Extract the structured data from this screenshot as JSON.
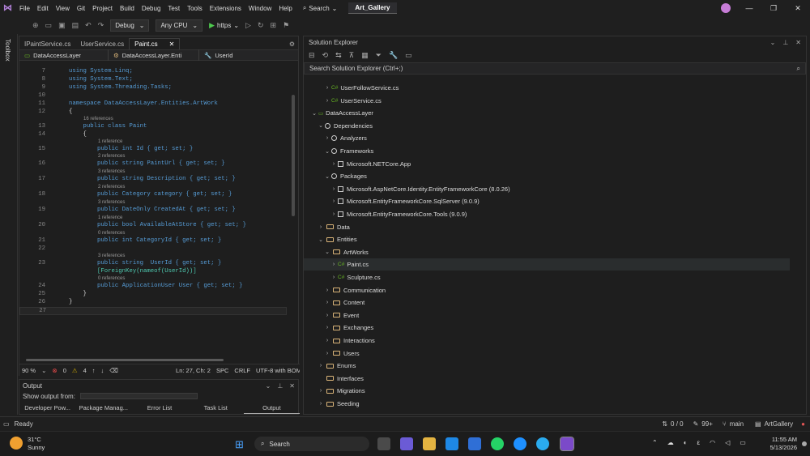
{
  "titlebar": {
    "menu": [
      "File",
      "Edit",
      "View",
      "Git",
      "Project",
      "Build",
      "Debug",
      "Test",
      "Tools",
      "Extensions",
      "Window",
      "Help"
    ],
    "search_label": "Search",
    "solution_name": "Art_Gallery"
  },
  "toolbar": {
    "config": "Debug",
    "platform": "Any CPU",
    "run_label": "https"
  },
  "toolbox_label": "Toolbox",
  "editor": {
    "tabs": [
      "IPaintService.cs",
      "UserService.cs",
      "Paint.cs"
    ],
    "nav": {
      "project": "DataAccessLayer",
      "type": "DataAccessLayer.Enti",
      "member": "UserId"
    },
    "status": {
      "zoom": "90 %",
      "errors": "0",
      "warnings": "4",
      "position": "Ln: 27, Ch: 2",
      "spc": "SPC",
      "eol": "CRLF",
      "encoding": "UTF-8 with BOM"
    }
  },
  "code": {
    "lines": [
      {
        "n": "7",
        "t": "using System.Linq;"
      },
      {
        "n": "8",
        "t": "using System.Text;"
      },
      {
        "n": "9",
        "t": "using System.Threading.Tasks;"
      },
      {
        "n": "10",
        "t": ""
      },
      {
        "n": "11",
        "t": "namespace DataAccessLayer.Entities.ArtWork"
      },
      {
        "n": "12",
        "t": "{"
      },
      {
        "n": "13",
        "t": "    public class Paint",
        "ref": "16 references"
      },
      {
        "n": "14",
        "t": "    {"
      },
      {
        "n": "15",
        "t": "        public int Id { get; set; }",
        "ref": "1 reference"
      },
      {
        "n": "16",
        "t": "        public string PaintUrl { get; set; }",
        "ref": "2 references"
      },
      {
        "n": "17",
        "t": "        public string Description { get; set; }",
        "ref": "3 references"
      },
      {
        "n": "18",
        "t": "        public Category category { get; set; }",
        "ref": "2 references"
      },
      {
        "n": "19",
        "t": "        public DateOnly CreatedAt { get; set; }",
        "ref": "3 references"
      },
      {
        "n": "20",
        "t": "        public bool AvailableAtStore { get; set; }",
        "ref": "1 reference"
      },
      {
        "n": "21",
        "t": "        public int CategoryId { get; set; }",
        "ref": "0 references"
      },
      {
        "n": "22",
        "t": ""
      },
      {
        "n": "23",
        "t": "        public string  UserId { get; set; }",
        "ref": "3 references"
      },
      {
        "n": "",
        "t": "        [ForeignKey(nameof(UserId))]"
      },
      {
        "n": "24",
        "t": "        public ApplicationUser User { get; set; }",
        "ref": "0 references"
      },
      {
        "n": "25",
        "t": "    }"
      },
      {
        "n": "26",
        "t": "}"
      },
      {
        "n": "27",
        "t": ""
      }
    ]
  },
  "output": {
    "title": "Output",
    "show_from": "Show output from:",
    "tabs": [
      "Developer Pow...",
      "Package Manag...",
      "Error List",
      "Task List",
      "Output"
    ]
  },
  "solution_explorer": {
    "title": "Solution Explorer",
    "search_placeholder": "Search Solution Explorer (Ctrl+;)",
    "items": [
      {
        "label": "UserFollowService.cs",
        "kind": "cs",
        "indent": 2,
        "chev": ">"
      },
      {
        "label": "UserService.cs",
        "kind": "cs",
        "indent": 2,
        "chev": ">"
      },
      {
        "label": "DataAccessLayer",
        "kind": "proj",
        "indent": 0,
        "chev": "v"
      },
      {
        "label": "Dependencies",
        "kind": "dep",
        "indent": 1,
        "chev": "v"
      },
      {
        "label": "Analyzers",
        "kind": "dep",
        "indent": 2,
        "chev": ">"
      },
      {
        "label": "Frameworks",
        "kind": "dep",
        "indent": 2,
        "chev": "v"
      },
      {
        "label": "Microsoft.NETCore.App",
        "kind": "pkg",
        "indent": 3,
        "chev": ">"
      },
      {
        "label": "Packages",
        "kind": "dep",
        "indent": 2,
        "chev": "v"
      },
      {
        "label": "Microsoft.AspNetCore.Identity.EntityFrameworkCore (8.0.26)",
        "kind": "pkg",
        "indent": 3,
        "chev": ">"
      },
      {
        "label": "Microsoft.EntityFrameworkCore.SqlServer (9.0.9)",
        "kind": "pkg",
        "indent": 3,
        "chev": ">"
      },
      {
        "label": "Microsoft.EntityFrameworkCore.Tools (9.0.9)",
        "kind": "pkg",
        "indent": 3,
        "chev": ">"
      },
      {
        "label": "Data",
        "kind": "folder",
        "indent": 1,
        "chev": ">"
      },
      {
        "label": "Entities",
        "kind": "folder",
        "indent": 1,
        "chev": "v"
      },
      {
        "label": "ArtWorks",
        "kind": "folder",
        "indent": 2,
        "chev": "v"
      },
      {
        "label": "Paint.cs",
        "kind": "cs",
        "indent": 3,
        "chev": ">",
        "selected": true
      },
      {
        "label": "Sculpture.cs",
        "kind": "cs",
        "indent": 3,
        "chev": ">"
      },
      {
        "label": "Communication",
        "kind": "folder",
        "indent": 2,
        "chev": ">"
      },
      {
        "label": "Content",
        "kind": "folder",
        "indent": 2,
        "chev": ">"
      },
      {
        "label": "Event",
        "kind": "folder",
        "indent": 2,
        "chev": ">"
      },
      {
        "label": "Exchanges",
        "kind": "folder",
        "indent": 2,
        "chev": ">"
      },
      {
        "label": "Interactions",
        "kind": "folder",
        "indent": 2,
        "chev": ">"
      },
      {
        "label": "Users",
        "kind": "folder",
        "indent": 2,
        "chev": ">"
      },
      {
        "label": "Enums",
        "kind": "folder",
        "indent": 1,
        "chev": ">"
      },
      {
        "label": "Interfaces",
        "kind": "folder",
        "indent": 1,
        "chev": ""
      },
      {
        "label": "Migrations",
        "kind": "folder",
        "indent": 1,
        "chev": ">"
      },
      {
        "label": "Seeding",
        "kind": "folder",
        "indent": 1,
        "chev": ">"
      }
    ]
  },
  "statusbar": {
    "ready": "Ready",
    "changes": "0 / 0",
    "edits": "99+",
    "branch": "main",
    "repo": "ArtGallery"
  },
  "taskbar": {
    "temp": "31°C",
    "weather": "Sunny",
    "search": "Search",
    "time": "11:55 AM",
    "date": "5/13/2026"
  }
}
